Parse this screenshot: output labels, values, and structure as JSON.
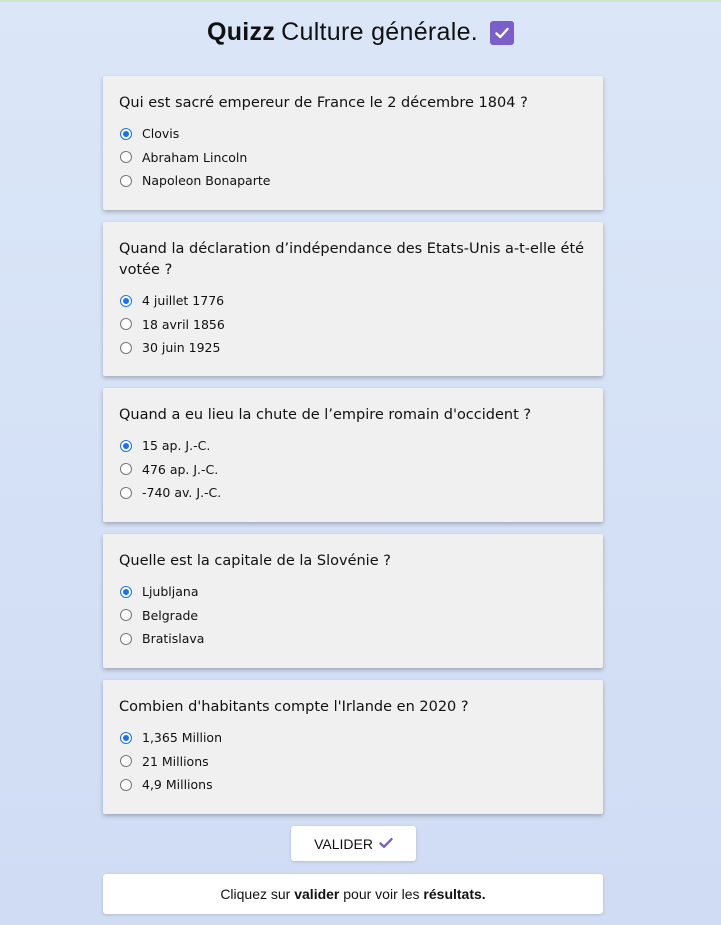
{
  "header": {
    "brand": "Quizz",
    "title": "Culture générale."
  },
  "questions": [
    {
      "text": "Qui est sacré empereur de France le 2 décembre 1804 ?",
      "options": [
        "Clovis",
        "Abraham Lincoln",
        "Napoleon Bonaparte"
      ],
      "selected": 0
    },
    {
      "text": "Quand la déclaration d’indépendance des Etats-Unis a-t-elle été votée ?",
      "options": [
        "4 juillet 1776",
        "18 avril 1856",
        "30 juin 1925"
      ],
      "selected": 0
    },
    {
      "text": "Quand a eu lieu la chute de l’empire romain d'occident ?",
      "options": [
        "15 ap. J.-C.",
        "476 ap. J.-C.",
        "-740 av. J.-C."
      ],
      "selected": 0
    },
    {
      "text": "Quelle est la capitale de la Slovénie ?",
      "options": [
        "Ljubljana",
        "Belgrade",
        "Bratislava"
      ],
      "selected": 0
    },
    {
      "text": "Combien d'habitants compte l'Irlande en 2020 ?",
      "options": [
        "1,365 Million",
        "21 Millions",
        "4,9 Millions"
      ],
      "selected": 0
    }
  ],
  "actions": {
    "validate_label": "VALIDER"
  },
  "result": {
    "prefix": "Cliquez sur",
    "keyword": "valider",
    "middle": "pour voir les",
    "keyword2": "résultats."
  },
  "colors": {
    "accent": "#7b5ec9",
    "radio": "#1a73e8",
    "card": "#f0f0f0"
  }
}
